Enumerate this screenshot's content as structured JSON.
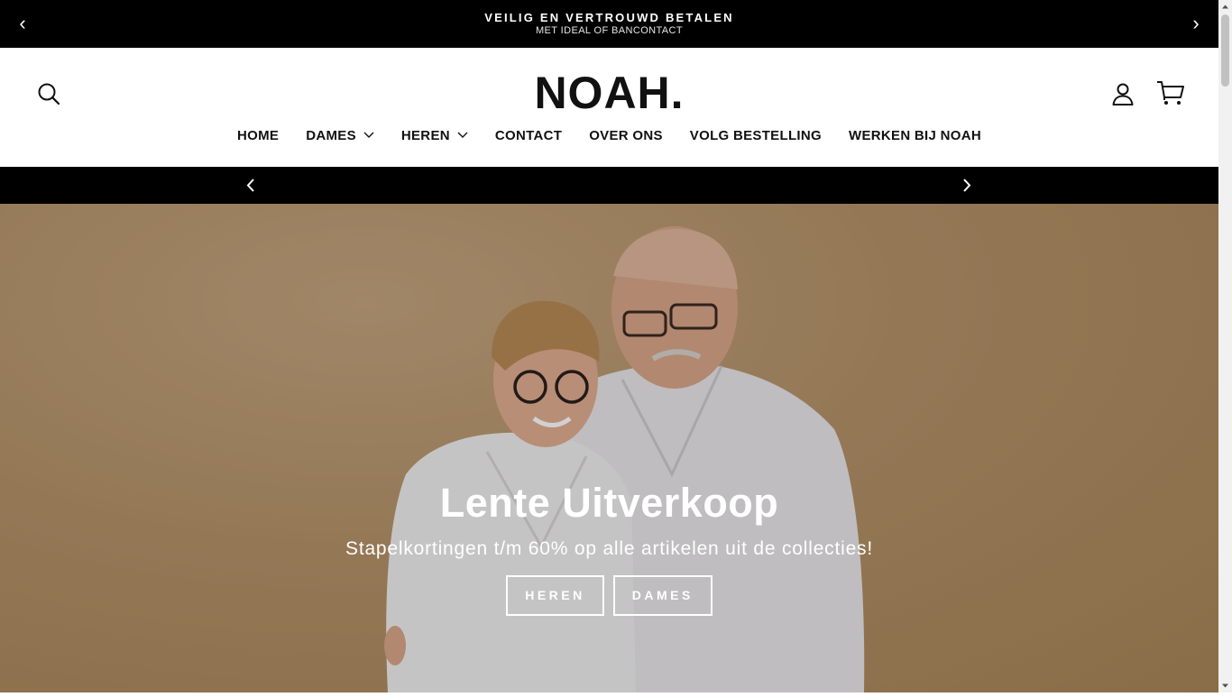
{
  "announcement": {
    "title": "VEILIG EN VERTROUWD BETALEN",
    "subtitle": "MET IDEAL OF BANCONTACT",
    "prev_icon": "‹",
    "next_icon": "›"
  },
  "header": {
    "logo": "NOAH.",
    "icons": [
      "search-icon",
      "account-icon",
      "cart-icon"
    ]
  },
  "nav": {
    "items": [
      {
        "label": "HOME"
      },
      {
        "label": "DAMES",
        "has_dropdown": true
      },
      {
        "label": "HEREN",
        "has_dropdown": true
      },
      {
        "label": "CONTACT"
      },
      {
        "label": "OVER ONS"
      },
      {
        "label": "VOLG BESTELLING"
      },
      {
        "label": "WERKEN BIJ NOAH"
      }
    ]
  },
  "hero": {
    "title": "Lente Uitverkoop",
    "subtitle": "Stapelkortingen t/m 60% op alle artikelen uit de collecties!",
    "buttons": [
      {
        "label": "HEREN"
      },
      {
        "label": "DAMES"
      }
    ]
  },
  "colors": {
    "bar_background": "#000000",
    "hero_background": "#b5936a",
    "text_light": "#ffffff"
  }
}
